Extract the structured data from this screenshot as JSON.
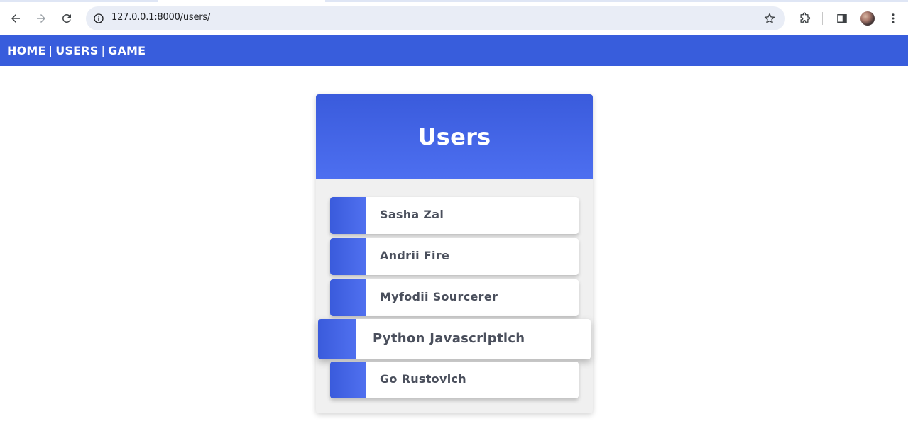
{
  "browser": {
    "url": "127.0.0.1:8000/users/"
  },
  "site_nav": {
    "links": [
      "HOME",
      "USERS",
      "GAME"
    ],
    "separator": "|"
  },
  "users_card": {
    "title": "Users",
    "users": [
      {
        "name": "Sasha Zal"
      },
      {
        "name": "Andrii Fire"
      },
      {
        "name": "Myfodii Sourcerer"
      },
      {
        "name": "Python Javascriptich"
      },
      {
        "name": "Go Rustovich"
      }
    ]
  },
  "colors": {
    "accent": "#385ddc",
    "card_background": "#f0f0f0",
    "user_name_text": "#4a4f5c"
  }
}
